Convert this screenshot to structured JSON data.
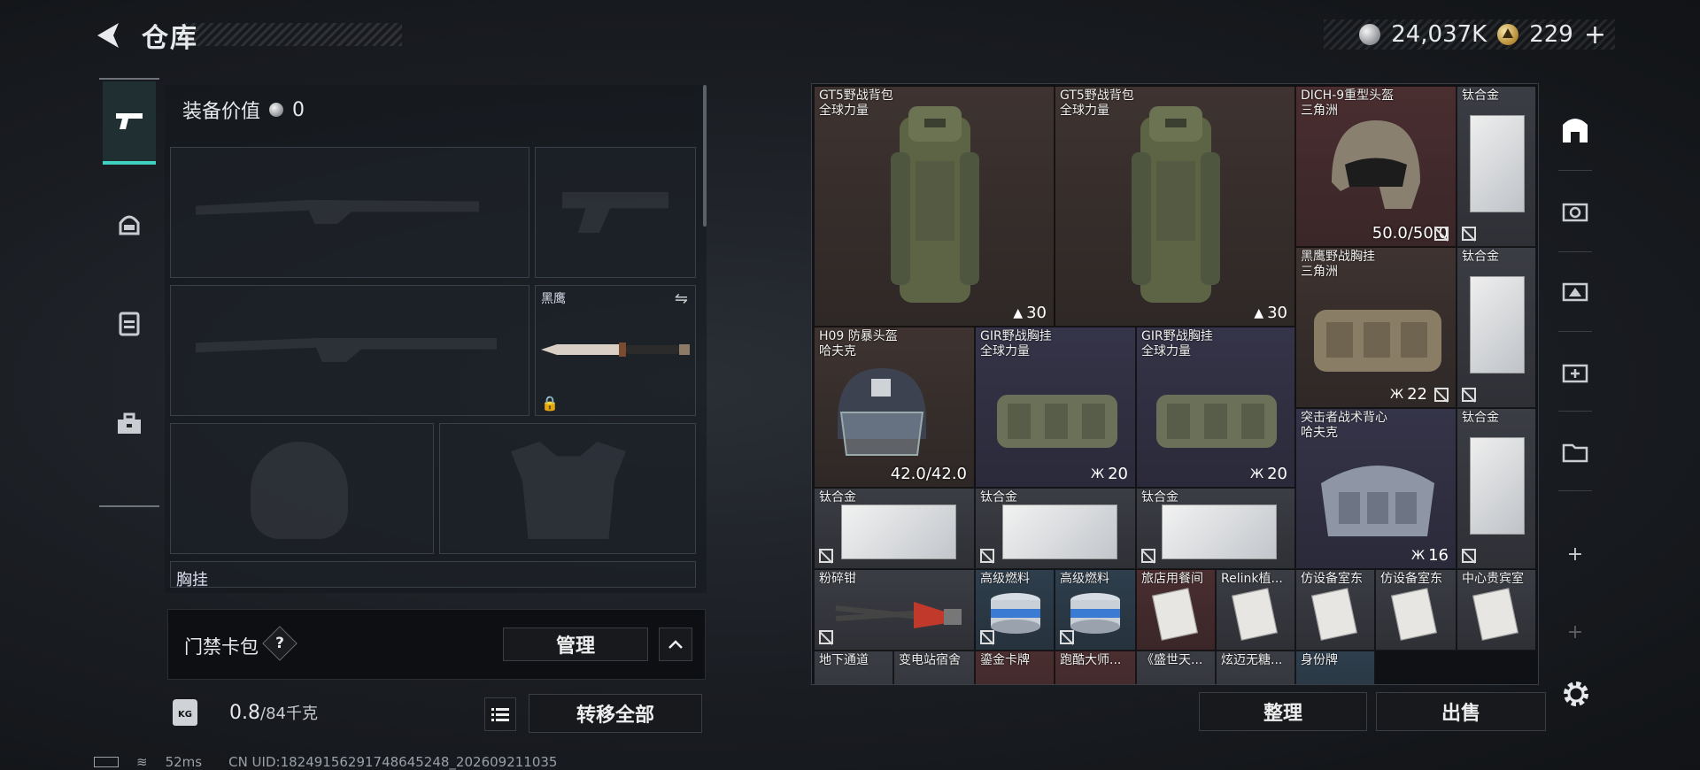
{
  "header": {
    "title": "仓库",
    "currency_silver": "24,037K",
    "currency_gold": "229",
    "add_label": "+"
  },
  "tabs": [
    {
      "icon": "pistol-icon",
      "active": true
    },
    {
      "icon": "helmet-icon",
      "active": false
    },
    {
      "icon": "vest-icon",
      "active": false
    },
    {
      "icon": "toolbox-icon",
      "active": false
    }
  ],
  "equipment": {
    "value_label": "装备价值",
    "value": "0",
    "melee_label": "黑鹰",
    "chest_label": "胸挂",
    "card_pack_label": "门禁卡包",
    "help_label": "?",
    "manage_label": "管理",
    "weight_current": "0.8",
    "weight_max": "/84千克",
    "transfer_all_label": "转移全部",
    "kg_label": "KG"
  },
  "storage": {
    "items": [
      {
        "name": "GT5野战背包",
        "sub": "全球力量",
        "count": "30"
      },
      {
        "name": "GT5野战背包",
        "sub": "全球力量",
        "count": "30"
      },
      {
        "name": "DICH-9重型头盔",
        "sub": "三角洲",
        "value": "50.0/50.0"
      },
      {
        "name": "钛合金"
      },
      {
        "name": "黑鹰野战胸挂",
        "sub": "三角洲",
        "count": "22"
      },
      {
        "name": "钛合金"
      },
      {
        "name": "H09 防暴头盔",
        "sub": "哈夫克",
        "value": "42.0/42.0"
      },
      {
        "name": "GIR野战胸挂",
        "sub": "全球力量",
        "count": "20"
      },
      {
        "name": "GIR野战胸挂",
        "sub": "全球力量",
        "count": "20"
      },
      {
        "name": "突击者战术背心",
        "sub": "哈夫克",
        "count": "16"
      },
      {
        "name": "钛合金"
      },
      {
        "name": "钛合金"
      },
      {
        "name": "钛合金"
      },
      {
        "name": "钛合金"
      },
      {
        "name": "粉碎钳"
      },
      {
        "name": "高级燃料"
      },
      {
        "name": "高级燃料"
      },
      {
        "name": "旅店用餐间"
      },
      {
        "name": "Relink植..."
      },
      {
        "name": "仿设备室东"
      },
      {
        "name": "仿设备室东"
      },
      {
        "name": "中心贵宾室"
      },
      {
        "name": "地下通道"
      },
      {
        "name": "变电站宿舍"
      },
      {
        "name": "鎏金卡牌"
      },
      {
        "name": "跑酷大师..."
      },
      {
        "name": "《盛世天..."
      },
      {
        "name": "炫迈无糖..."
      },
      {
        "name": "身份牌"
      }
    ],
    "sort_label": "整理",
    "sell_label": "出售"
  },
  "right_nav": {
    "add1": "+",
    "add2": "+"
  },
  "status_bar": {
    "ping": "52ms",
    "uid": "CN UID:18249156291748645248_202609211035"
  }
}
